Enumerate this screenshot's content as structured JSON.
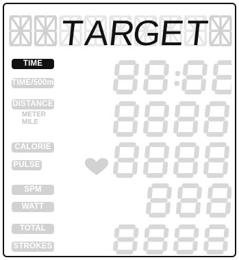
{
  "display": {
    "title": "TARGET",
    "title_cells": [
      "",
      "",
      "T",
      "A",
      "R",
      "G",
      "E",
      "T",
      ""
    ],
    "labels": {
      "time": "TIME",
      "time500": "TIME/500m",
      "distance": "DISTANCE",
      "meter": "METER",
      "mile": "MILE",
      "calorie": "CALORIE",
      "pulse": "PULSE",
      "spm": "SPM",
      "watt": "WATT",
      "total": "TOTAL",
      "strokes": "STROKES"
    },
    "readouts": {
      "time": "88:88",
      "distance": "8888",
      "calorie": "8888",
      "spm": "888",
      "total": "8888"
    },
    "active_label": "TIME",
    "icons": [
      "heart-icon"
    ],
    "colors": {
      "active": "#111111",
      "inactive": "#d2d2d2",
      "segment_off": "#d8d8d8",
      "segment_on": "#111111"
    }
  }
}
